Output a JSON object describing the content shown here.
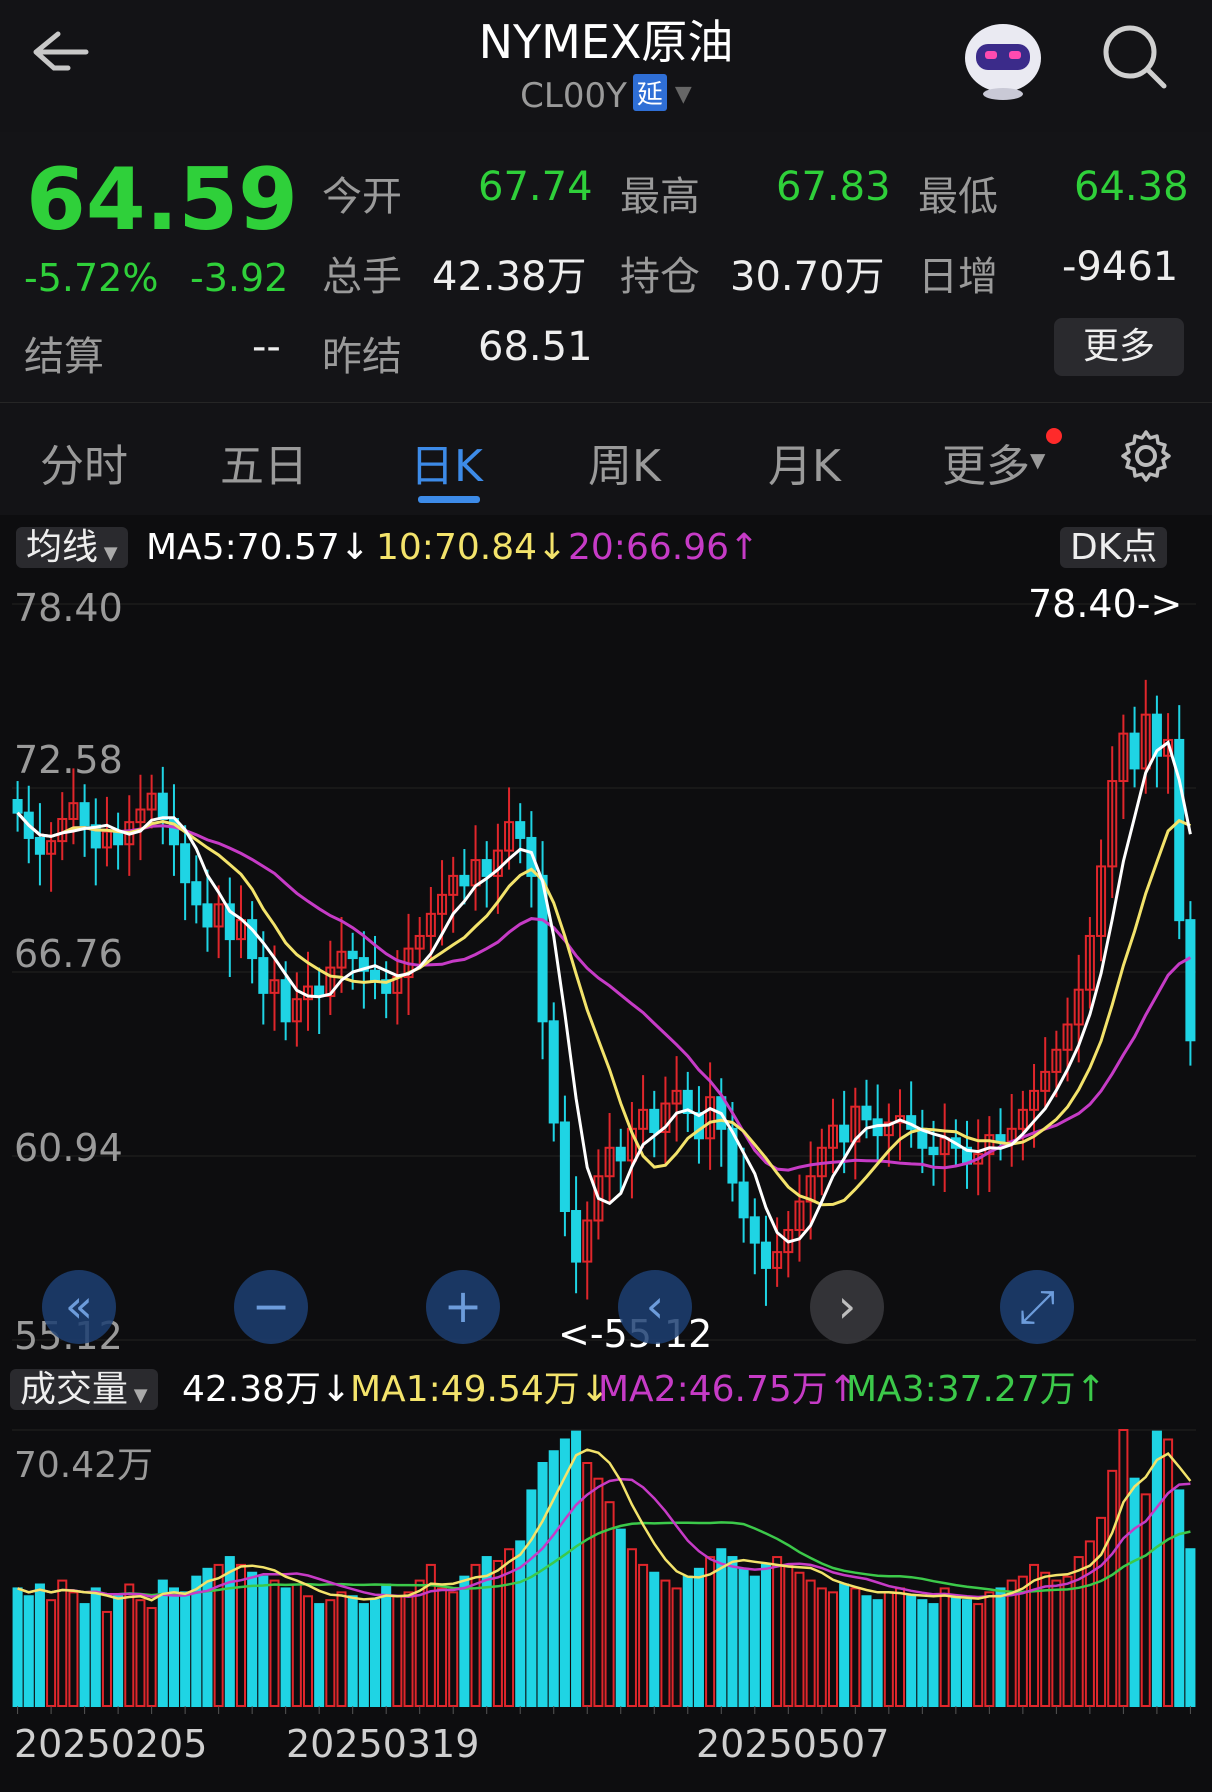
{
  "header": {
    "title": "NYMEX原油",
    "code": "CL00Y",
    "delay_tag": "延"
  },
  "quote": {
    "price": "64.59",
    "change_pct": "-5.72%",
    "change": "-3.92",
    "open_label": "今开",
    "open": "67.74",
    "high_label": "最高",
    "high": "67.83",
    "low_label": "最低",
    "low": "64.38",
    "volume_label": "总手",
    "volume": "42.38万",
    "position_label": "持仓",
    "position": "30.70万",
    "daily_inc_label": "日增",
    "daily_inc": "-9461",
    "settle_label": "结算",
    "settle": "--",
    "prev_settle_label": "昨结",
    "prev_settle": "68.51",
    "more_label": "更多"
  },
  "tabs": [
    "分时",
    "五日",
    "日K",
    "周K",
    "月K",
    "更多"
  ],
  "active_tab": "日K",
  "ma_bar": {
    "selector": "均线",
    "ma5": "MA5:70.57↓",
    "ma10": "10:70.84↓",
    "ma20": "20:66.96↑",
    "dk_label": "DK点"
  },
  "price_axis": [
    "78.40",
    "72.58",
    "66.76",
    "60.94",
    "55.12"
  ],
  "annotations": {
    "max": "78.40->",
    "min": "<-55.12"
  },
  "vol_bar": {
    "selector": "成交量",
    "vol": "42.38万↓",
    "ma1": "MA1:49.54万↓",
    "ma2": "MA2:46.75万↑",
    "ma3": "MA3:37.27万↑"
  },
  "vol_axis": "70.42万",
  "dates": [
    "20250205",
    "20250319",
    "20250507"
  ],
  "colors": {
    "up": "#e0262b",
    "down": "#1fd4e4",
    "ma5": "#ffffff",
    "ma10": "#f3e36b",
    "ma20": "#c63bc6",
    "vol_ma3": "#3cc94a"
  },
  "chart_data": {
    "type": "candlestick",
    "ylim": [
      55.12,
      78.4
    ],
    "close": [
      71.8,
      71.0,
      70.5,
      70.9,
      71.6,
      72.1,
      71.4,
      70.7,
      71.2,
      70.8,
      71.5,
      71.9,
      72.4,
      71.6,
      70.8,
      69.6,
      68.9,
      68.2,
      68.9,
      67.8,
      68.4,
      67.2,
      66.1,
      66.5,
      65.2,
      65.9,
      66.3,
      66.0,
      66.9,
      67.4,
      67.2,
      66.8,
      66.5,
      66.1,
      66.6,
      67.5,
      67.9,
      68.6,
      69.2,
      69.8,
      69.5,
      70.3,
      69.8,
      70.6,
      71.5,
      71.0,
      69.8,
      65.2,
      62.0,
      59.2,
      57.6,
      58.9,
      60.3,
      61.2,
      60.8,
      61.8,
      62.4,
      61.7,
      62.6,
      63.0,
      62.3,
      61.5,
      62.8,
      61.8,
      60.1,
      59.0,
      58.2,
      57.4,
      57.9,
      58.6,
      59.5,
      60.3,
      61.2,
      61.9,
      61.4,
      62.5,
      62.1,
      61.6,
      62.0,
      62.2,
      61.8,
      61.2,
      61.0,
      61.5,
      61.2,
      60.7,
      61.0,
      61.6,
      61.4,
      61.8,
      62.4,
      63.0,
      63.6,
      64.3,
      65.1,
      66.2,
      67.9,
      70.1,
      72.8,
      74.3,
      73.2,
      74.9,
      73.6,
      74.1,
      68.4,
      64.6
    ],
    "vol_values": [
      0.3,
      0.28,
      0.31,
      0.27,
      0.32,
      0.29,
      0.26,
      0.3,
      0.24,
      0.28,
      0.31,
      0.27,
      0.25,
      0.32,
      0.3,
      0.29,
      0.33,
      0.35,
      0.36,
      0.38,
      0.36,
      0.34,
      0.33,
      0.32,
      0.3,
      0.31,
      0.28,
      0.26,
      0.27,
      0.29,
      0.28,
      0.26,
      0.27,
      0.31,
      0.28,
      0.29,
      0.32,
      0.36,
      0.3,
      0.29,
      0.33,
      0.36,
      0.38,
      0.37,
      0.4,
      0.42,
      0.55,
      0.62,
      0.65,
      0.68,
      0.7,
      0.62,
      0.58,
      0.52,
      0.45,
      0.4,
      0.36,
      0.34,
      0.32,
      0.3,
      0.33,
      0.35,
      0.38,
      0.4,
      0.38,
      0.35,
      0.33,
      0.36,
      0.38,
      0.36,
      0.34,
      0.32,
      0.3,
      0.29,
      0.31,
      0.3,
      0.28,
      0.27,
      0.29,
      0.3,
      0.28,
      0.27,
      0.26,
      0.3,
      0.28,
      0.27,
      0.26,
      0.29,
      0.3,
      0.32,
      0.33,
      0.36,
      0.34,
      0.32,
      0.33,
      0.38,
      0.42,
      0.48,
      0.6,
      0.72,
      0.58,
      0.54,
      0.7,
      0.68,
      0.55,
      0.4
    ],
    "vol_max": 0.7042,
    "vol_unit": "万",
    "x_dates": [
      "20250205",
      "20250319",
      "20250507"
    ]
  }
}
